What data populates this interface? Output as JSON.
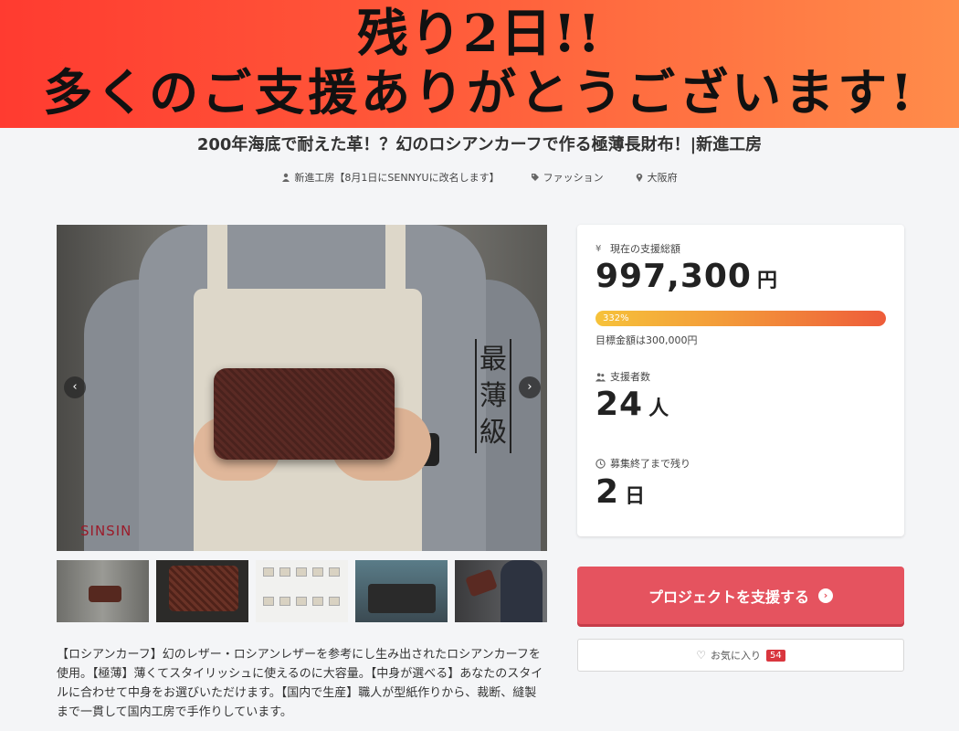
{
  "banner": {
    "line1": "残り2日!!",
    "line2": "多くのご支援ありがとうございます!"
  },
  "project": {
    "title": "200年海底で耐えた革！？幻のロシアンカーフで作る極薄長財布！|新進工房",
    "owner": "新進工房【8月1日にSENNYUに改名します】",
    "category": "ファッション",
    "location": "大阪府",
    "description": "【ロシアンカーフ】幻のレザー・ロシアンレザーを参考にし生み出されたロシアンカーフを使用。【極薄】薄くてスタイリッシュに使えるのに大容量。【中身が選べる】あなたのスタイルに合わせて中身をお選びいただけます。【国内で生産】職人が型紙作りから、裁断、縫製まで一貫して国内工房で手作りしています。"
  },
  "gallery": {
    "stamp_text": "最薄級",
    "brand_text": "SINSIN",
    "prev_icon": "chevron-left-icon",
    "next_icon": "chevron-right-icon"
  },
  "stats": {
    "total_label": "現在の支援総額",
    "total_value": "997,300",
    "total_unit": "円",
    "progress_percent": 332,
    "progress_label": "332%",
    "goal_label": "目標金額は300,000円",
    "backers_label": "支援者数",
    "backers_value": "24",
    "backers_unit": "人",
    "remaining_label": "募集終了まで残り",
    "remaining_value": "2",
    "remaining_unit": "日"
  },
  "actions": {
    "support_label": "プロジェクトを支援する",
    "favorite_label": "お気に入り",
    "favorite_count": "54"
  },
  "colors": {
    "support_button": "#e5535f",
    "badge": "#d9363e",
    "banner_start": "#ff3b30",
    "banner_end": "#ff8c4a"
  }
}
